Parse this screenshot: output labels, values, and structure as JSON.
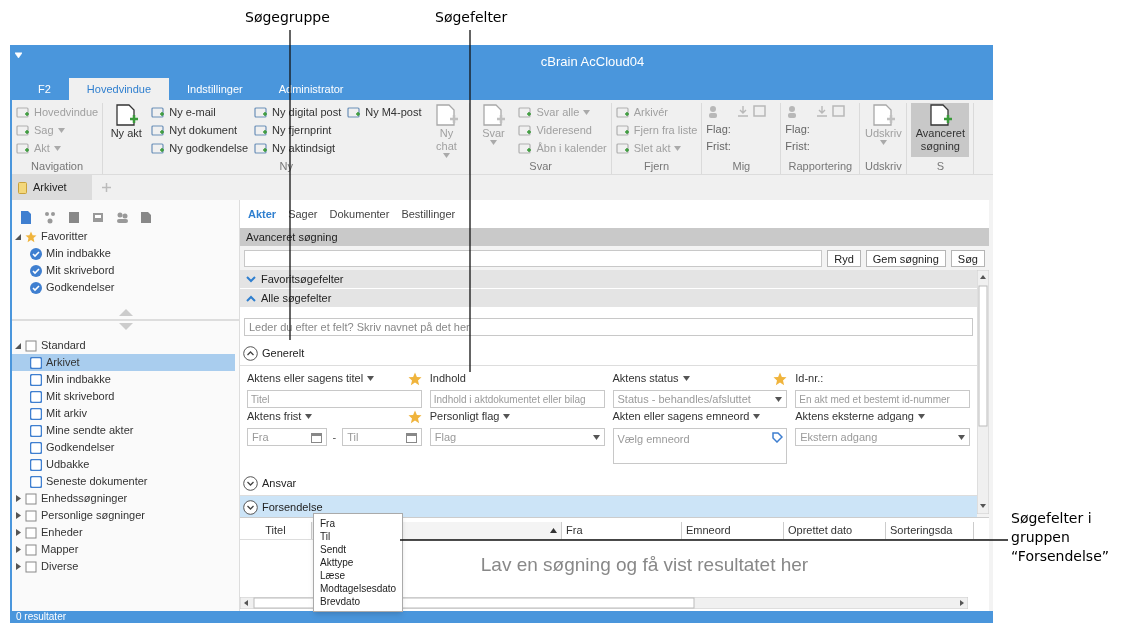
{
  "annotations": [
    {
      "text": "Søgegruppe"
    },
    {
      "text": "Søgefelter"
    },
    {
      "text": "Søgefelter i gruppen “Forsendelse”"
    }
  ],
  "window": {
    "title": "cBrain AcCloud04"
  },
  "ribbon_tabs": [
    {
      "label": "F2",
      "selected": false
    },
    {
      "label": "Hovedvindue",
      "selected": true
    },
    {
      "label": "Indstillinger",
      "selected": false
    },
    {
      "label": "Administrator",
      "selected": false
    }
  ],
  "ribbon_groups": [
    {
      "label": "Navigation",
      "columns": [
        [
          {
            "kind": "small",
            "label": "Hovedvindue",
            "disabled": true,
            "menu": false
          },
          {
            "kind": "small",
            "label": "Sag",
            "disabled": true,
            "menu": true
          },
          {
            "kind": "small",
            "label": "Akt",
            "disabled": true,
            "menu": true
          }
        ]
      ]
    },
    {
      "label": "Ny",
      "columns": [
        [
          {
            "kind": "large",
            "label": "Ny akt",
            "disabled": false,
            "menu": false
          }
        ],
        [
          {
            "kind": "small",
            "label": "Ny e-mail",
            "disabled": false,
            "menu": false
          },
          {
            "kind": "small",
            "label": "Nyt dokument",
            "disabled": false,
            "menu": false
          },
          {
            "kind": "small",
            "label": "Ny godkendelse",
            "disabled": false,
            "menu": false
          }
        ],
        [
          {
            "kind": "small",
            "label": "Ny digital post",
            "disabled": false,
            "menu": false
          },
          {
            "kind": "small",
            "label": "Ny fjernprint",
            "disabled": false,
            "menu": false
          },
          {
            "kind": "small",
            "label": "Ny aktindsigt",
            "disabled": false,
            "menu": false
          }
        ],
        [
          {
            "kind": "small",
            "label": "Ny M4-post",
            "disabled": false,
            "menu": false
          }
        ],
        [
          {
            "kind": "large",
            "label": "Ny chat",
            "disabled": true,
            "menu": true
          }
        ]
      ]
    },
    {
      "label": "Svar",
      "columns": [
        [
          {
            "kind": "large",
            "label": "Svar",
            "disabled": true,
            "menu": true
          }
        ],
        [
          {
            "kind": "small",
            "label": "Svar alle",
            "disabled": true,
            "menu": true
          },
          {
            "kind": "small",
            "label": "Videresend",
            "disabled": true,
            "menu": false
          },
          {
            "kind": "small",
            "label": "Åbn i kalender",
            "disabled": true,
            "menu": false
          }
        ]
      ]
    },
    {
      "label": "Fjern",
      "columns": [
        [
          {
            "kind": "small",
            "label": "Arkivér",
            "disabled": true,
            "menu": false
          },
          {
            "kind": "small",
            "label": "Fjern fra liste",
            "disabled": true,
            "menu": false
          },
          {
            "kind": "small",
            "label": "Slet akt",
            "disabled": true,
            "menu": true
          }
        ]
      ]
    },
    {
      "label": "Mig",
      "columns": [
        [
          {
            "kind": "icon_row"
          },
          {
            "kind": "text",
            "label": "Flag:"
          },
          {
            "kind": "text",
            "label": "Frist:"
          }
        ]
      ]
    },
    {
      "label": "Rapportering",
      "columns": [
        [
          {
            "kind": "icon_row"
          },
          {
            "kind": "text",
            "label": "Flag:"
          },
          {
            "kind": "text",
            "label": "Frist:"
          }
        ]
      ]
    },
    {
      "label": "Udskriv",
      "columns": [
        [
          {
            "kind": "large",
            "label": "Udskriv",
            "disabled": true,
            "menu": true
          }
        ]
      ]
    },
    {
      "label": "S",
      "columns": [
        [
          {
            "kind": "large",
            "label": "Avanceret søgning",
            "disabled": false,
            "menu": false,
            "selected": true
          }
        ]
      ]
    }
  ],
  "doc_tabs": [
    {
      "label": "Arkivet",
      "selected": true
    }
  ],
  "favorites": [
    {
      "label": "Favoritter",
      "expanded": true,
      "selected": false,
      "children": [
        {
          "label": "Min indbakke",
          "selected": false
        },
        {
          "label": "Mit skrivebord",
          "selected": false
        },
        {
          "label": "Godkendelser",
          "selected": false
        }
      ]
    }
  ],
  "tree": [
    {
      "label": "Standard",
      "expanded": true,
      "selected": false,
      "children": [
        {
          "label": "Arkivet",
          "selected": true
        },
        {
          "label": "Min indbakke",
          "selected": false
        },
        {
          "label": "Mit skrivebord",
          "selected": false
        },
        {
          "label": "Mit arkiv",
          "selected": false
        },
        {
          "label": "Mine sendte akter",
          "selected": false
        },
        {
          "label": "Godkendelser",
          "selected": false
        },
        {
          "label": "Udbakke",
          "selected": false
        },
        {
          "label": "Seneste dokumenter",
          "selected": false
        }
      ]
    },
    {
      "label": "Enhedssøgninger",
      "expanded": false,
      "selected": false
    },
    {
      "label": "Personlige søgninger",
      "expanded": false,
      "selected": false
    },
    {
      "label": "Enheder",
      "expanded": false,
      "selected": false
    },
    {
      "label": "Mapper",
      "expanded": false,
      "selected": false
    },
    {
      "label": "Diverse",
      "expanded": false,
      "selected": false
    }
  ],
  "sub_tabs": [
    {
      "label": "Akter",
      "selected": true
    },
    {
      "label": "Sager",
      "selected": false
    },
    {
      "label": "Dokumenter",
      "selected": false
    },
    {
      "label": "Bestillinger",
      "selected": false
    }
  ],
  "panel_title": "Avanceret søgning",
  "search_buttons": [
    "Ryd",
    "Gem søgning",
    "Søg"
  ],
  "sections": [
    {
      "label": "Favoritsøgefelter",
      "expanded": false
    },
    {
      "label": "Alle søgefelter",
      "expanded": true
    }
  ],
  "field_filter": {
    "placeholder": "Leder du efter et felt? Skriv navnet på det her"
  },
  "groups": [
    {
      "label": "Generelt",
      "expanded": true,
      "highlighted": false,
      "fields": [
        {
          "kind": "text",
          "label": "Aktens eller sagens titel",
          "menu": true,
          "favorite": true,
          "placeholder": "Titel"
        },
        {
          "kind": "text",
          "label": "Indhold",
          "menu": false,
          "favorite": false,
          "placeholder": "Indhold i aktdokumentet eller bilag"
        },
        {
          "kind": "dropdown",
          "label": "Aktens status",
          "menu": true,
          "favorite": true,
          "placeholder": "Status - behandles/afsluttet"
        },
        {
          "kind": "text",
          "label": "Id-nr.:",
          "menu": false,
          "favorite": false,
          "placeholder": "En akt med et bestemt id-nummer"
        },
        {
          "kind": "date_range",
          "label": "Aktens frist",
          "menu": true,
          "favorite": true,
          "placeholders": [
            "Fra",
            "Til"
          ],
          "separator": "-"
        },
        {
          "kind": "dropdown",
          "label": "Personligt flag",
          "menu": true,
          "favorite": false,
          "placeholder": "Flag"
        },
        {
          "kind": "tags",
          "label": "Akten eller sagens emneord",
          "menu": true,
          "favorite": false,
          "placeholder": "Vælg emneord"
        },
        {
          "kind": "dropdown",
          "label": "Aktens eksterne adgang",
          "menu": true,
          "favorite": false,
          "placeholder": "Ekstern adgang"
        }
      ]
    },
    {
      "label": "Ansvar",
      "expanded": false,
      "highlighted": false
    },
    {
      "label": "Forsendelse",
      "expanded": false,
      "highlighted": true
    }
  ],
  "results": {
    "columns": [
      {
        "label": "Titel",
        "sorted": false
      },
      {
        "sorted": true
      },
      {
        "label": "Fra",
        "sorted": false
      },
      {
        "label": "Emneord",
        "sorted": false
      },
      {
        "label": "Oprettet dato",
        "sorted": false
      },
      {
        "label": "Sorteringsda",
        "sorted": false
      }
    ],
    "empty_message": "Lav en søgning og få vist resultatet her"
  },
  "popup_list": [
    "Fra",
    "Til",
    "Sendt",
    "Akttype",
    "Læse",
    "Modtagelsesdato",
    "Brevdato"
  ],
  "status_bar": "0 resultater"
}
